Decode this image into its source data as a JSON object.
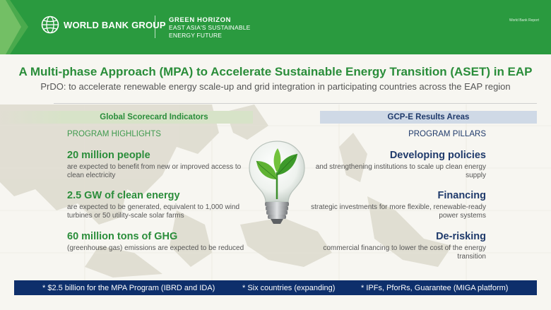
{
  "header": {
    "org_name": "WORLD BANK GROUP",
    "program_title": "GREEN  HORIZON",
    "program_sub1": "EAST ASIA'S SUSTAINABLE",
    "program_sub2": "ENERGY FUTURE",
    "report_label": "World Bank Report",
    "colors": {
      "header_green": "#2a9a3f"
    }
  },
  "title": "A Multi-phase Approach (MPA)  to Accelerate Sustainable Energy Transition (ASET) in EAP",
  "subtitle": "PrDO: to accelerate renewable energy scale-up and grid integration in participating countries across the EAP region",
  "left": {
    "header": "Global Scorecard Indicators",
    "label": "PROGRAM HIGHLIGHTS",
    "items": [
      {
        "headline": "20 million people",
        "desc": "are expected to benefit from new or improved access to clean electricity"
      },
      {
        "headline": "2.5 GW of clean energy",
        "desc": "are expected to be generated, equivalent to 1,000 wind turbines or 50 utility-scale solar farms"
      },
      {
        "headline": "60 million tons of GHG",
        "desc": "(greenhouse gas) emissions are expected to be reduced"
      }
    ]
  },
  "right": {
    "header": "GCP-E Results Areas",
    "label": "PROGRAM PILLARS",
    "items": [
      {
        "headline": "Developing policies",
        "desc": "and strengthening institutions to scale up clean energy supply"
      },
      {
        "headline": "Financing",
        "desc": "strategic investments for more flexible, renewable-ready power systems"
      },
      {
        "headline": "De-risking",
        "desc": "commercial financing to lower the cost of the energy transition"
      }
    ]
  },
  "footer": {
    "items": [
      "* $2.5 billion for the MPA Program (IBRD and IDA)",
      "* Six countries (expanding)",
      "* IPFs, PforRs, Guarantee (MIGA platform)"
    ]
  },
  "icons": [
    "world-bank-globe-icon",
    "lightbulb-leaves-icon",
    "map-background"
  ]
}
